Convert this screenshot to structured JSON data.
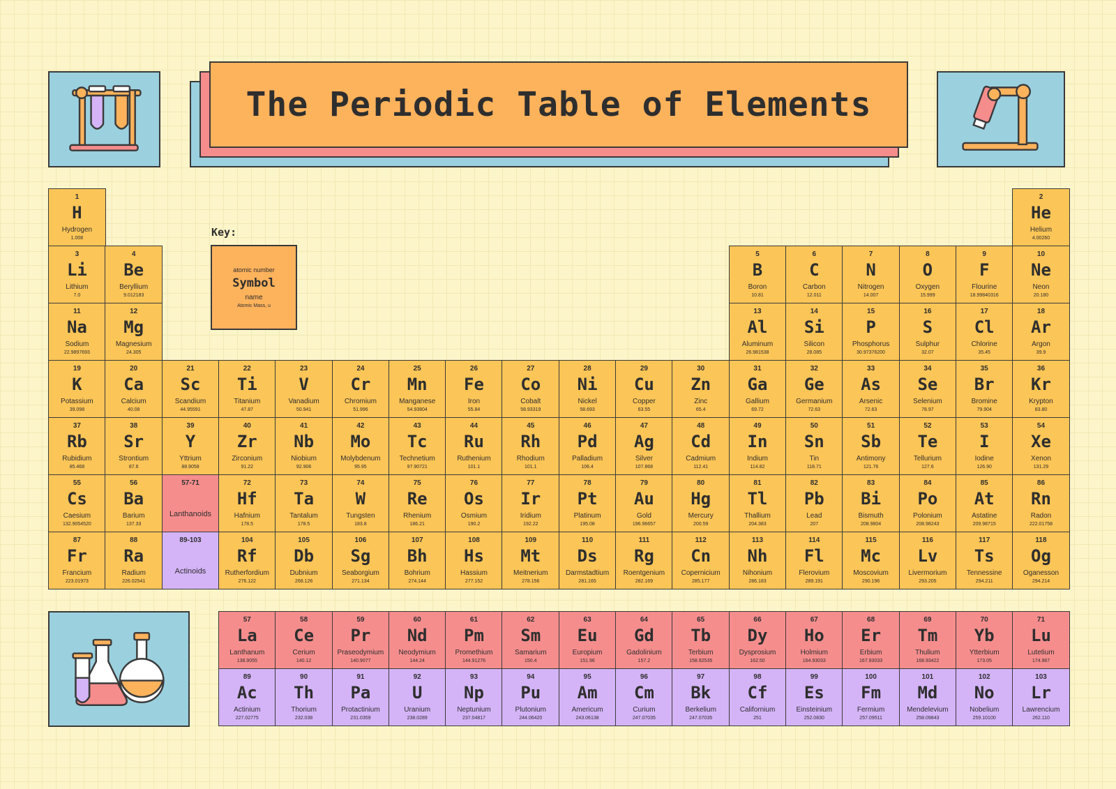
{
  "title": "The Periodic Table of Elements",
  "key": {
    "label": "Key:",
    "atomic_number": "atomic number",
    "symbol": "Symbol",
    "name": "name",
    "mass": "Atomic Mass, u"
  },
  "colors": {
    "main": "#fcc557",
    "lanthanide": "#f68d8d",
    "actinide": "#d4b4f7",
    "icon_bg": "#9bd0df",
    "title_bg": "#fdb25c"
  },
  "icons": [
    "test-tubes-icon",
    "microscope-icon",
    "flasks-icon"
  ],
  "elements": [
    {
      "n": "1",
      "s": "H",
      "name": "Hydrogen",
      "m": "1.008",
      "p": 1,
      "g": 1
    },
    {
      "n": "2",
      "s": "He",
      "name": "Helium",
      "m": "4.00260",
      "p": 1,
      "g": 18
    },
    {
      "n": "3",
      "s": "Li",
      "name": "Lithium",
      "m": "7.0",
      "p": 2,
      "g": 1
    },
    {
      "n": "4",
      "s": "Be",
      "name": "Beryllium",
      "m": "9.012183",
      "p": 2,
      "g": 2
    },
    {
      "n": "5",
      "s": "B",
      "name": "Boron",
      "m": "10.81",
      "p": 2,
      "g": 13
    },
    {
      "n": "6",
      "s": "C",
      "name": "Carbon",
      "m": "12.011",
      "p": 2,
      "g": 14
    },
    {
      "n": "7",
      "s": "N",
      "name": "Nitrogen",
      "m": "14.007",
      "p": 2,
      "g": 15
    },
    {
      "n": "8",
      "s": "O",
      "name": "Oxygen",
      "m": "15.999",
      "p": 2,
      "g": 16
    },
    {
      "n": "9",
      "s": "F",
      "name": "Flourine",
      "m": "18.99840316",
      "p": 2,
      "g": 17
    },
    {
      "n": "10",
      "s": "Ne",
      "name": "Neon",
      "m": "20.180",
      "p": 2,
      "g": 18
    },
    {
      "n": "11",
      "s": "Na",
      "name": "Sodium",
      "m": "22.9897693",
      "p": 3,
      "g": 1
    },
    {
      "n": "12",
      "s": "Mg",
      "name": "Magnesium",
      "m": "24.305",
      "p": 3,
      "g": 2
    },
    {
      "n": "13",
      "s": "Al",
      "name": "Aluminum",
      "m": "26.981538",
      "p": 3,
      "g": 13
    },
    {
      "n": "14",
      "s": "Si",
      "name": "Silicon",
      "m": "28.085",
      "p": 3,
      "g": 14
    },
    {
      "n": "15",
      "s": "P",
      "name": "Phosphorus",
      "m": "30.97376200",
      "p": 3,
      "g": 15
    },
    {
      "n": "16",
      "s": "S",
      "name": "Sulphur",
      "m": "32.07",
      "p": 3,
      "g": 16
    },
    {
      "n": "17",
      "s": "Cl",
      "name": "Chlorine",
      "m": "35.45",
      "p": 3,
      "g": 17
    },
    {
      "n": "18",
      "s": "Ar",
      "name": "Argon",
      "m": "39.9",
      "p": 3,
      "g": 18
    },
    {
      "n": "19",
      "s": "K",
      "name": "Potassium",
      "m": "39.098",
      "p": 4,
      "g": 1
    },
    {
      "n": "20",
      "s": "Ca",
      "name": "Calcium",
      "m": "40.08",
      "p": 4,
      "g": 2
    },
    {
      "n": "21",
      "s": "Sc",
      "name": "Scandium",
      "m": "44.95591",
      "p": 4,
      "g": 3
    },
    {
      "n": "22",
      "s": "Ti",
      "name": "Titanium",
      "m": "47.87",
      "p": 4,
      "g": 4
    },
    {
      "n": "23",
      "s": "V",
      "name": "Vanadium",
      "m": "50.941",
      "p": 4,
      "g": 5
    },
    {
      "n": "24",
      "s": "Cr",
      "name": "Chromium",
      "m": "51.996",
      "p": 4,
      "g": 6
    },
    {
      "n": "25",
      "s": "Mn",
      "name": "Manganese",
      "m": "54.93804",
      "p": 4,
      "g": 7
    },
    {
      "n": "26",
      "s": "Fe",
      "name": "Iron",
      "m": "55.84",
      "p": 4,
      "g": 8
    },
    {
      "n": "27",
      "s": "Co",
      "name": "Cobalt",
      "m": "58.93319",
      "p": 4,
      "g": 9
    },
    {
      "n": "28",
      "s": "Ni",
      "name": "Nickel",
      "m": "58.693",
      "p": 4,
      "g": 10
    },
    {
      "n": "29",
      "s": "Cu",
      "name": "Copper",
      "m": "63.55",
      "p": 4,
      "g": 11
    },
    {
      "n": "30",
      "s": "Zn",
      "name": "Zinc",
      "m": "65.4",
      "p": 4,
      "g": 12
    },
    {
      "n": "31",
      "s": "Ga",
      "name": "Gallium",
      "m": "69.72",
      "p": 4,
      "g": 13
    },
    {
      "n": "32",
      "s": "Ge",
      "name": "Germanium",
      "m": "72.63",
      "p": 4,
      "g": 14
    },
    {
      "n": "33",
      "s": "As",
      "name": "Arsenic",
      "m": "72.63",
      "p": 4,
      "g": 15
    },
    {
      "n": "34",
      "s": "Se",
      "name": "Selenium",
      "m": "78.97",
      "p": 4,
      "g": 16
    },
    {
      "n": "35",
      "s": "Br",
      "name": "Bromine",
      "m": "79.904",
      "p": 4,
      "g": 17
    },
    {
      "n": "36",
      "s": "Kr",
      "name": "Krypton",
      "m": "83.80",
      "p": 4,
      "g": 18
    },
    {
      "n": "37",
      "s": "Rb",
      "name": "Rubidium",
      "m": "85.468",
      "p": 5,
      "g": 1
    },
    {
      "n": "38",
      "s": "Sr",
      "name": "Strontium",
      "m": "87.6",
      "p": 5,
      "g": 2
    },
    {
      "n": "39",
      "s": "Y",
      "name": "Yttrium",
      "m": "88.9058",
      "p": 5,
      "g": 3
    },
    {
      "n": "40",
      "s": "Zr",
      "name": "Zirconium",
      "m": "91.22",
      "p": 5,
      "g": 4
    },
    {
      "n": "41",
      "s": "Nb",
      "name": "Niobium",
      "m": "92.906",
      "p": 5,
      "g": 5
    },
    {
      "n": "42",
      "s": "Mo",
      "name": "Molybdenum",
      "m": "95.95",
      "p": 5,
      "g": 6
    },
    {
      "n": "43",
      "s": "Tc",
      "name": "Technetium",
      "m": "97.90721",
      "p": 5,
      "g": 7
    },
    {
      "n": "44",
      "s": "Ru",
      "name": "Ruthenium",
      "m": "101.1",
      "p": 5,
      "g": 8
    },
    {
      "n": "45",
      "s": "Rh",
      "name": "Rhodium",
      "m": "101.1",
      "p": 5,
      "g": 9
    },
    {
      "n": "46",
      "s": "Pd",
      "name": "Palladium",
      "m": "106.4",
      "p": 5,
      "g": 10
    },
    {
      "n": "47",
      "s": "Ag",
      "name": "Silver",
      "m": "107.868",
      "p": 5,
      "g": 11
    },
    {
      "n": "48",
      "s": "Cd",
      "name": "Cadmium",
      "m": "112.41",
      "p": 5,
      "g": 12
    },
    {
      "n": "49",
      "s": "In",
      "name": "Indium",
      "m": "114.82",
      "p": 5,
      "g": 13
    },
    {
      "n": "50",
      "s": "Sn",
      "name": "Tin",
      "m": "118.71",
      "p": 5,
      "g": 14
    },
    {
      "n": "51",
      "s": "Sb",
      "name": "Antimony",
      "m": "121.76",
      "p": 5,
      "g": 15
    },
    {
      "n": "52",
      "s": "Te",
      "name": "Tellurium",
      "m": "127.6",
      "p": 5,
      "g": 16
    },
    {
      "n": "53",
      "s": "I",
      "name": "Iodine",
      "m": "126.90",
      "p": 5,
      "g": 17
    },
    {
      "n": "54",
      "s": "Xe",
      "name": "Xenon",
      "m": "131.29",
      "p": 5,
      "g": 18
    },
    {
      "n": "55",
      "s": "Cs",
      "name": "Caesium",
      "m": "132.9054520",
      "p": 6,
      "g": 1
    },
    {
      "n": "56",
      "s": "Ba",
      "name": "Barium",
      "m": "137.33",
      "p": 6,
      "g": 2
    },
    {
      "n": "57-71",
      "s": "",
      "name": "Lanthanoids",
      "m": "",
      "p": 6,
      "g": 3,
      "c": "red"
    },
    {
      "n": "72",
      "s": "Hf",
      "name": "Hafnium",
      "m": "178.5",
      "p": 6,
      "g": 4
    },
    {
      "n": "73",
      "s": "Ta",
      "name": "Tantalum",
      "m": "178.5",
      "p": 6,
      "g": 5
    },
    {
      "n": "74",
      "s": "W",
      "name": "Tungsten",
      "m": "183.8",
      "p": 6,
      "g": 6
    },
    {
      "n": "75",
      "s": "Re",
      "name": "Rhenium",
      "m": "186.21",
      "p": 6,
      "g": 7
    },
    {
      "n": "76",
      "s": "Os",
      "name": "Osmium",
      "m": "190.2",
      "p": 6,
      "g": 8
    },
    {
      "n": "77",
      "s": "Ir",
      "name": "Iridium",
      "m": "192.22",
      "p": 6,
      "g": 9
    },
    {
      "n": "78",
      "s": "Pt",
      "name": "Platinum",
      "m": "195.08",
      "p": 6,
      "g": 10
    },
    {
      "n": "79",
      "s": "Au",
      "name": "Gold",
      "m": "196.96657",
      "p": 6,
      "g": 11
    },
    {
      "n": "80",
      "s": "Hg",
      "name": "Mercury",
      "m": "200.59",
      "p": 6,
      "g": 12
    },
    {
      "n": "81",
      "s": "Tl",
      "name": "Thallium",
      "m": "204.383",
      "p": 6,
      "g": 13
    },
    {
      "n": "82",
      "s": "Pb",
      "name": "Lead",
      "m": "207",
      "p": 6,
      "g": 14
    },
    {
      "n": "83",
      "s": "Bi",
      "name": "Bismuth",
      "m": "208.9804",
      "p": 6,
      "g": 15
    },
    {
      "n": "84",
      "s": "Po",
      "name": "Polonium",
      "m": "208.98243",
      "p": 6,
      "g": 16
    },
    {
      "n": "85",
      "s": "At",
      "name": "Astatine",
      "m": "209.98715",
      "p": 6,
      "g": 17
    },
    {
      "n": "86",
      "s": "Rn",
      "name": "Radon",
      "m": "222.01758",
      "p": 6,
      "g": 18
    },
    {
      "n": "87",
      "s": "Fr",
      "name": "Francium",
      "m": "223.01973",
      "p": 7,
      "g": 1
    },
    {
      "n": "88",
      "s": "Ra",
      "name": "Radium",
      "m": "226.02541",
      "p": 7,
      "g": 2
    },
    {
      "n": "89-103",
      "s": "",
      "name": "Actinoids",
      "m": "",
      "p": 7,
      "g": 3,
      "c": "purple"
    },
    {
      "n": "104",
      "s": "Rf",
      "name": "Rutherfordium",
      "m": "276.122",
      "p": 7,
      "g": 4
    },
    {
      "n": "105",
      "s": "Db",
      "name": "Dubnium",
      "m": "268.126",
      "p": 7,
      "g": 5
    },
    {
      "n": "106",
      "s": "Sg",
      "name": "Seaborgium",
      "m": "271.134",
      "p": 7,
      "g": 6
    },
    {
      "n": "107",
      "s": "Bh",
      "name": "Bohrium",
      "m": "274.144",
      "p": 7,
      "g": 7
    },
    {
      "n": "108",
      "s": "Hs",
      "name": "Hassium",
      "m": "277.152",
      "p": 7,
      "g": 8
    },
    {
      "n": "109",
      "s": "Mt",
      "name": "Meitnerium",
      "m": "278.156",
      "p": 7,
      "g": 9
    },
    {
      "n": "110",
      "s": "Ds",
      "name": "Darmstadtium",
      "m": "281.165",
      "p": 7,
      "g": 10
    },
    {
      "n": "111",
      "s": "Rg",
      "name": "Roentgenium",
      "m": "282.169",
      "p": 7,
      "g": 11
    },
    {
      "n": "112",
      "s": "Cn",
      "name": "Copernicium",
      "m": "285.177",
      "p": 7,
      "g": 12
    },
    {
      "n": "113",
      "s": "Nh",
      "name": "Nihonium",
      "m": "286.183",
      "p": 7,
      "g": 13
    },
    {
      "n": "114",
      "s": "Fl",
      "name": "Flerovium",
      "m": "289.191",
      "p": 7,
      "g": 14
    },
    {
      "n": "115",
      "s": "Mc",
      "name": "Moscovium",
      "m": "290.196",
      "p": 7,
      "g": 15
    },
    {
      "n": "116",
      "s": "Lv",
      "name": "Livermorium",
      "m": "293.205",
      "p": 7,
      "g": 16
    },
    {
      "n": "117",
      "s": "Ts",
      "name": "Tennessine",
      "m": "294.211",
      "p": 7,
      "g": 17
    },
    {
      "n": "118",
      "s": "Og",
      "name": "Oganesson",
      "m": "294.214",
      "p": 7,
      "g": 18
    },
    {
      "n": "57",
      "s": "La",
      "name": "Lanthanum",
      "m": "138.9055",
      "p": 8,
      "g": 4,
      "c": "red"
    },
    {
      "n": "58",
      "s": "Ce",
      "name": "Cerium",
      "m": "140.12",
      "p": 8,
      "g": 5,
      "c": "red"
    },
    {
      "n": "59",
      "s": "Pr",
      "name": "Praseodymium",
      "m": "140.9077",
      "p": 8,
      "g": 6,
      "c": "red"
    },
    {
      "n": "60",
      "s": "Nd",
      "name": "Neodymium",
      "m": "144.24",
      "p": 8,
      "g": 7,
      "c": "red"
    },
    {
      "n": "61",
      "s": "Pm",
      "name": "Promethium",
      "m": "144.91276",
      "p": 8,
      "g": 8,
      "c": "red"
    },
    {
      "n": "62",
      "s": "Sm",
      "name": "Samarium",
      "m": "150.4",
      "p": 8,
      "g": 9,
      "c": "red"
    },
    {
      "n": "63",
      "s": "Eu",
      "name": "Europium",
      "m": "151.96",
      "p": 8,
      "g": 10,
      "c": "red"
    },
    {
      "n": "64",
      "s": "Gd",
      "name": "Gadolinium",
      "m": "157.2",
      "p": 8,
      "g": 11,
      "c": "red"
    },
    {
      "n": "65",
      "s": "Tb",
      "name": "Terbium",
      "m": "158.92535",
      "p": 8,
      "g": 12,
      "c": "red"
    },
    {
      "n": "66",
      "s": "Dy",
      "name": "Dysprosium",
      "m": "162.50",
      "p": 8,
      "g": 13,
      "c": "red"
    },
    {
      "n": "67",
      "s": "Ho",
      "name": "Holmium",
      "m": "164.93033",
      "p": 8,
      "g": 14,
      "c": "red"
    },
    {
      "n": "68",
      "s": "Er",
      "name": "Erbium",
      "m": "167.93033",
      "p": 8,
      "g": 15,
      "c": "red"
    },
    {
      "n": "69",
      "s": "Tm",
      "name": "Thulium",
      "m": "168.93422",
      "p": 8,
      "g": 16,
      "c": "red"
    },
    {
      "n": "70",
      "s": "Yb",
      "name": "Ytterbium",
      "m": "173.05",
      "p": 8,
      "g": 17,
      "c": "red"
    },
    {
      "n": "71",
      "s": "Lu",
      "name": "Lutetium",
      "m": "174.967",
      "p": 8,
      "g": 18,
      "c": "red"
    },
    {
      "n": "89",
      "s": "Ac",
      "name": "Actinium",
      "m": "227.02775",
      "p": 9,
      "g": 4,
      "c": "purple"
    },
    {
      "n": "90",
      "s": "Th",
      "name": "Thorium",
      "m": "232.038",
      "p": 9,
      "g": 5,
      "c": "purple"
    },
    {
      "n": "91",
      "s": "Pa",
      "name": "Protactinium",
      "m": "231.0359",
      "p": 9,
      "g": 6,
      "c": "purple"
    },
    {
      "n": "92",
      "s": "U",
      "name": "Uranium",
      "m": "238.0289",
      "p": 9,
      "g": 7,
      "c": "purple"
    },
    {
      "n": "93",
      "s": "Np",
      "name": "Neptunium",
      "m": "237.04817",
      "p": 9,
      "g": 8,
      "c": "purple"
    },
    {
      "n": "94",
      "s": "Pu",
      "name": "Plutonium",
      "m": "244.06420",
      "p": 9,
      "g": 9,
      "c": "purple"
    },
    {
      "n": "95",
      "s": "Am",
      "name": "Americum",
      "m": "243.06138",
      "p": 9,
      "g": 10,
      "c": "purple"
    },
    {
      "n": "96",
      "s": "Cm",
      "name": "Curium",
      "m": "247.07035",
      "p": 9,
      "g": 11,
      "c": "purple"
    },
    {
      "n": "97",
      "s": "Bk",
      "name": "Berkelium",
      "m": "247.07035",
      "p": 9,
      "g": 12,
      "c": "purple"
    },
    {
      "n": "98",
      "s": "Cf",
      "name": "Californium",
      "m": "251",
      "p": 9,
      "g": 13,
      "c": "purple"
    },
    {
      "n": "99",
      "s": "Es",
      "name": "Einsteinium",
      "m": "252.0830",
      "p": 9,
      "g": 14,
      "c": "purple"
    },
    {
      "n": "100",
      "s": "Fm",
      "name": "Fermium",
      "m": "257.09511",
      "p": 9,
      "g": 15,
      "c": "purple"
    },
    {
      "n": "101",
      "s": "Md",
      "name": "Mendelevium",
      "m": "258.09843",
      "p": 9,
      "g": 16,
      "c": "purple"
    },
    {
      "n": "102",
      "s": "No",
      "name": "Nobelium",
      "m": "259.10100",
      "p": 9,
      "g": 17,
      "c": "purple"
    },
    {
      "n": "103",
      "s": "Lr",
      "name": "Lawrencium",
      "m": "262.110",
      "p": 9,
      "g": 18,
      "c": "purple"
    }
  ]
}
